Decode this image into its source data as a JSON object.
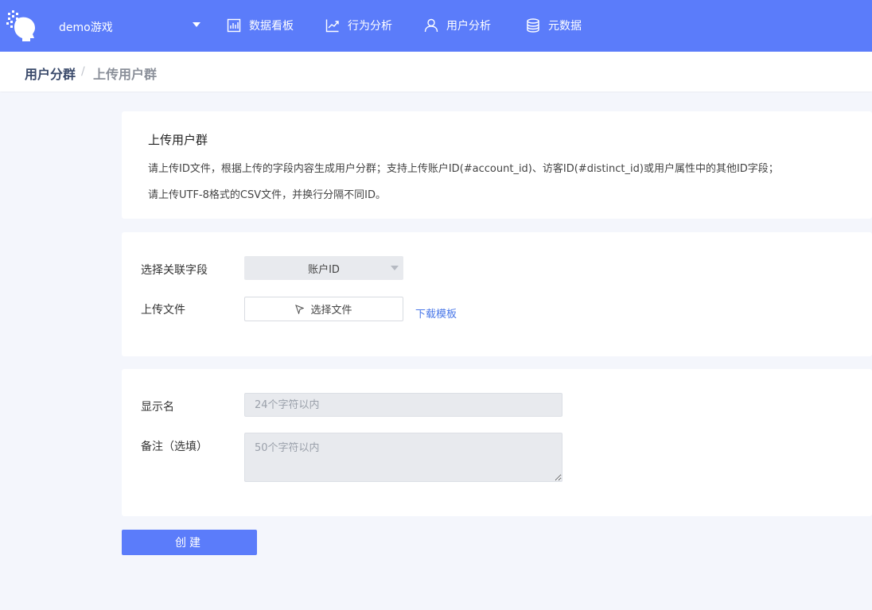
{
  "header": {
    "project_name": "demo游戏",
    "nav": [
      {
        "label": "数据看板",
        "icon": "bar-chart-icon"
      },
      {
        "label": "行为分析",
        "icon": "trend-line-icon"
      },
      {
        "label": "用户分析",
        "icon": "user-icon"
      },
      {
        "label": "元数据",
        "icon": "database-icon"
      }
    ],
    "brand_color": "#5b7cfa"
  },
  "breadcrumb": {
    "parent": "用户分群",
    "separator": "/",
    "current": "上传用户群"
  },
  "info_card": {
    "title": "上传用户群",
    "line1": "请上传ID文件，根据上传的字段内容生成用户分群；支持上传账户ID(#account_id)、访客ID(#distinct_id)或用户属性中的其他ID字段；",
    "line2": "请上传UTF-8格式的CSV文件，并换行分隔不同ID。"
  },
  "upload_form": {
    "field_label": "选择关联字段",
    "field_value": "账户ID",
    "file_label": "上传文件",
    "file_button": "选择文件",
    "download_link": "下载模板"
  },
  "name_form": {
    "display_name_label": "显示名",
    "display_name_placeholder": "24个字符以内",
    "remark_label": "备注（选填）",
    "remark_placeholder": "50个字符以内"
  },
  "actions": {
    "create_label": "创建"
  }
}
